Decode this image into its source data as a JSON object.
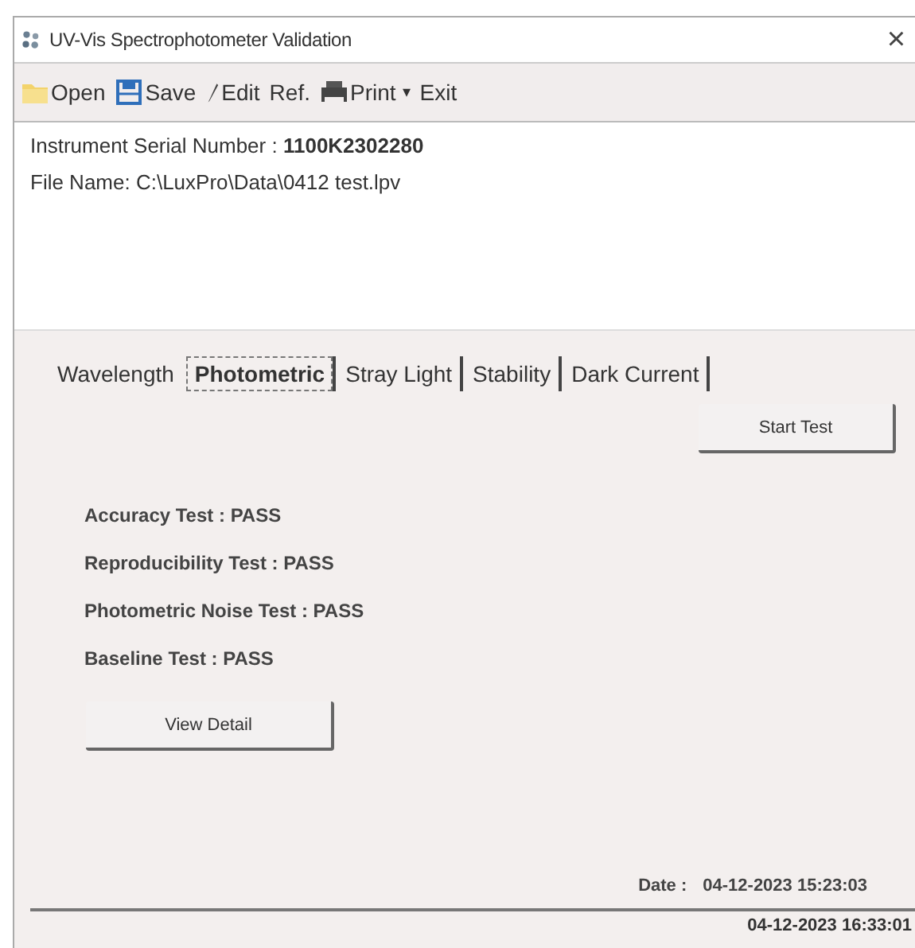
{
  "window": {
    "title": "UV-Vis Spectrophotometer Validation",
    "close": "×"
  },
  "toolbar": [
    {
      "kind": "open",
      "label": "Open"
    },
    {
      "kind": "save",
      "label": "Save"
    },
    {
      "kind": "edit",
      "label": "Edit"
    },
    {
      "kind": "plain",
      "label": "Ref."
    },
    {
      "kind": "print",
      "label": "Print",
      "dropdown": "▾"
    },
    {
      "kind": "plain",
      "label": "Exit"
    }
  ],
  "info": {
    "serial_label": "Instrument Serial Number :",
    "serial": "1100K2302280",
    "file": "File Name: C:\\LuxPro\\Data\\0412 test.lpv"
  },
  "tabs": [
    {
      "label": "Wavelength",
      "selected": false
    },
    {
      "label": "Photometric",
      "selected": true
    },
    {
      "label": "Stray Light",
      "selected": false
    },
    {
      "label": "Stability",
      "selected": false
    },
    {
      "label": "Dark Current",
      "selected": false
    }
  ],
  "start_button": "Start Test",
  "results": [
    "Accuracy Test : PASS",
    "Reproducibility Test : PASS",
    "Photometric Noise Test : PASS",
    "Baseline Test : PASS"
  ],
  "detail_button": "View Detail",
  "date": {
    "label": "Date :",
    "value": "04-12-2023 15:23:03"
  },
  "status_bar": "04-12-2023 16:33:01"
}
